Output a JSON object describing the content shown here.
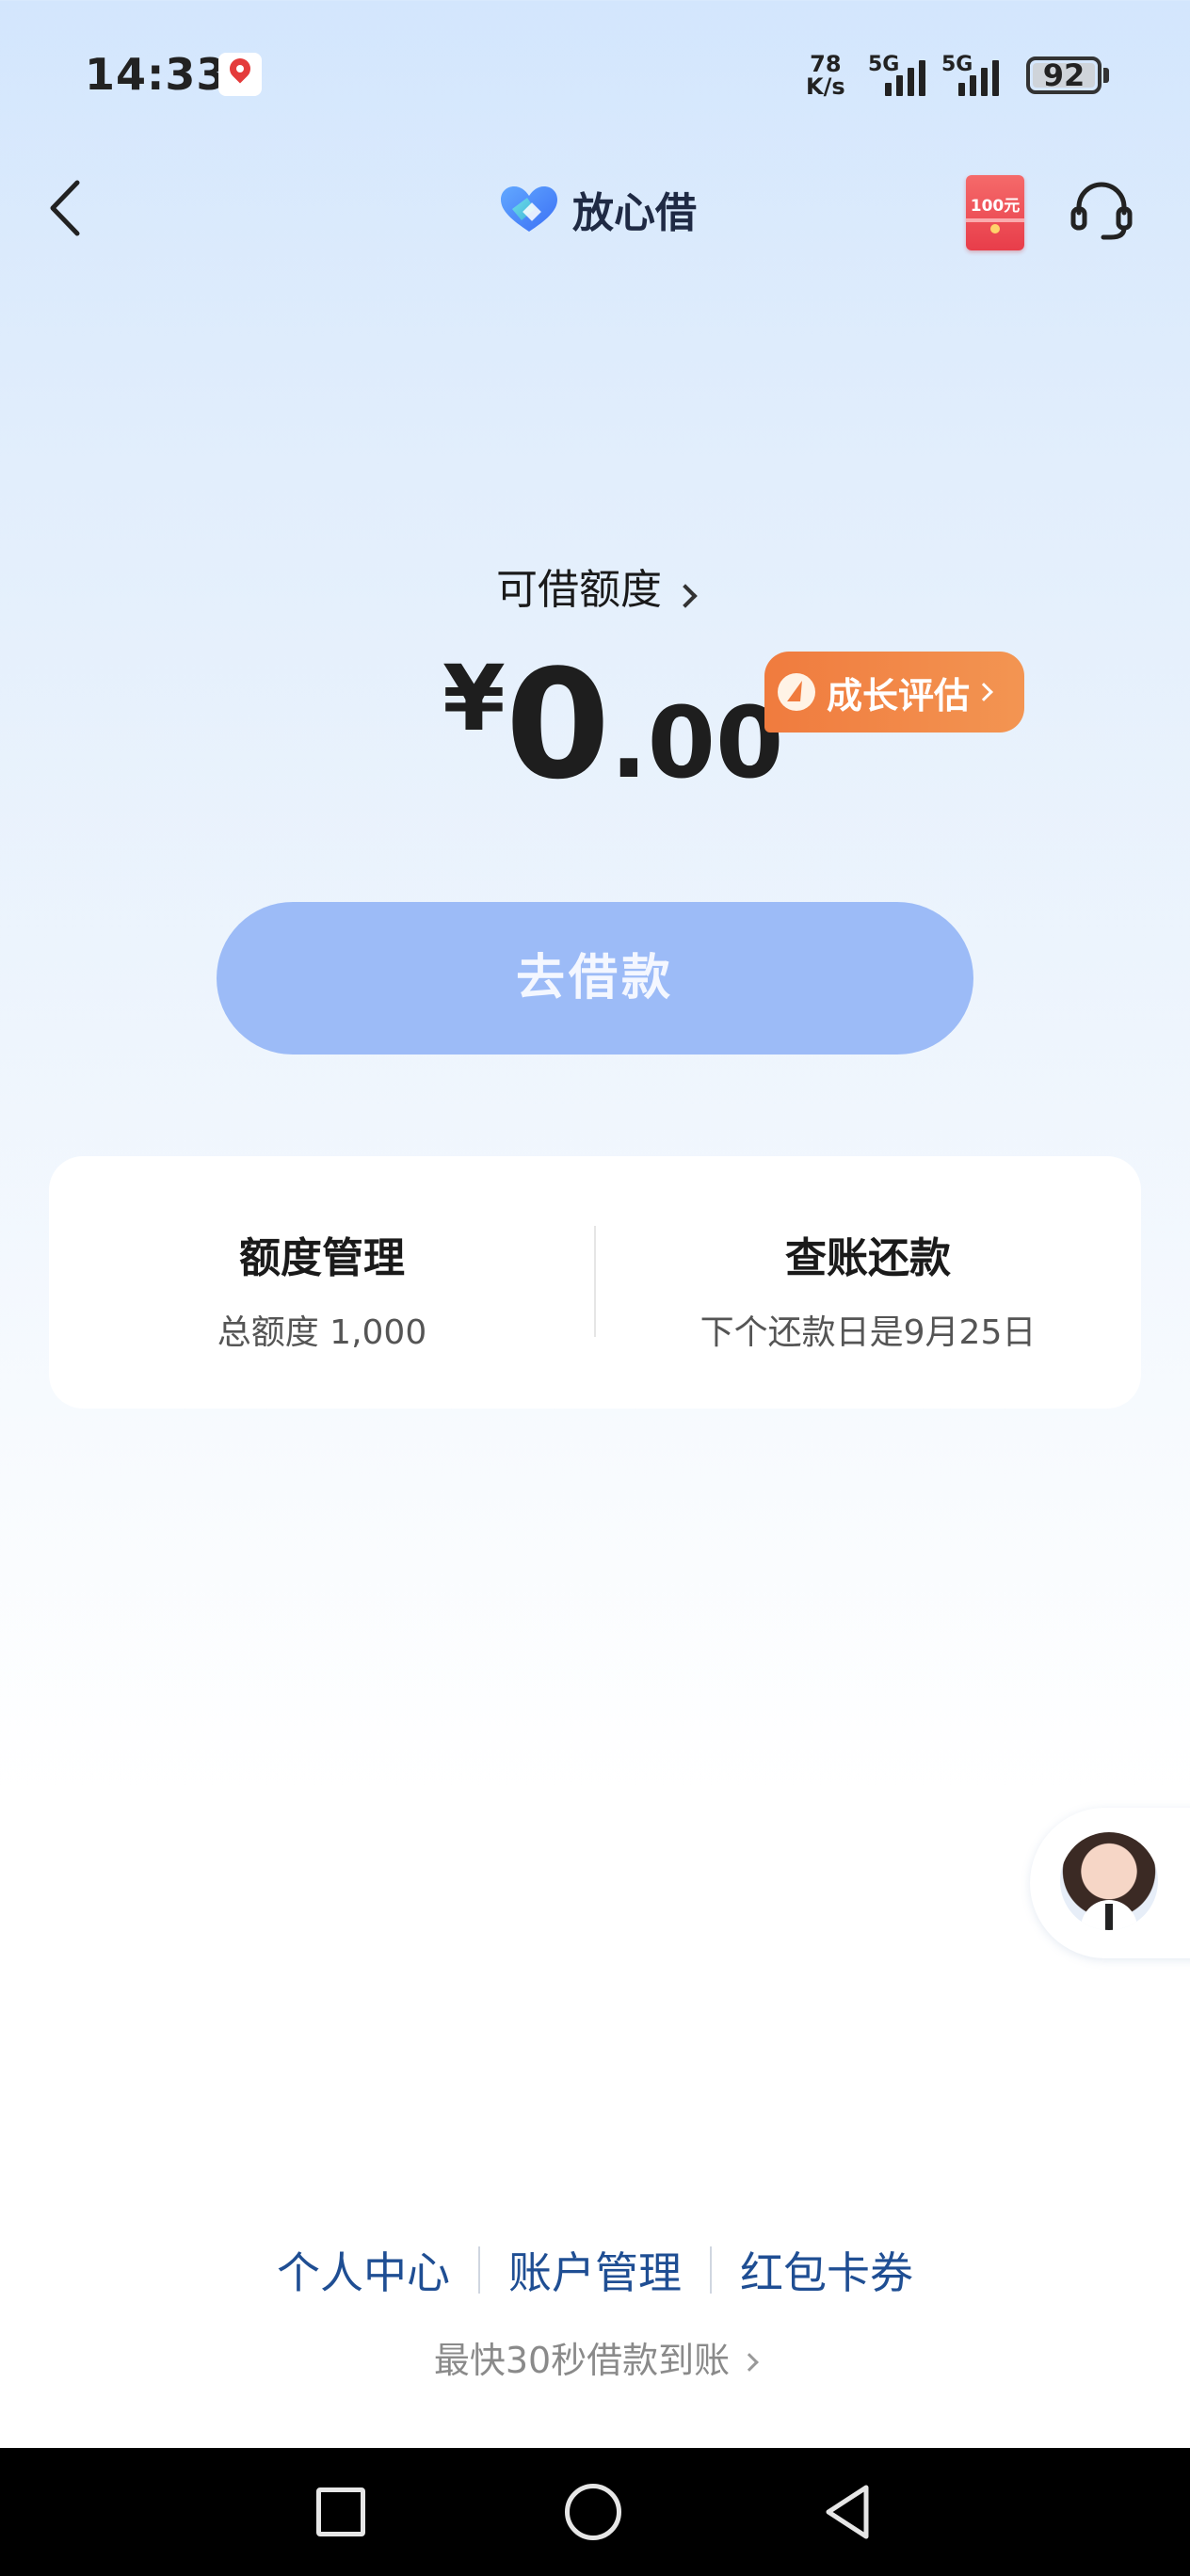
{
  "status_bar": {
    "time": "14:33",
    "net_speed_top": "78",
    "net_speed_bottom": "K/s",
    "signal_1": "5G",
    "signal_2": "5G",
    "battery": "92",
    "icons": [
      "baidu-map-icon",
      "signal-icon",
      "battery-icon"
    ]
  },
  "header": {
    "brand_name": "放心借",
    "redpacket_amount": "100元",
    "icons": [
      "back-icon",
      "brand-logo-icon",
      "red-packet-icon",
      "customer-service-icon"
    ]
  },
  "credit": {
    "label": "可借额度",
    "currency": "¥",
    "integer": "0",
    "decimal": ".00",
    "growth_label": "成长评估"
  },
  "borrow_button": {
    "label": "去借款"
  },
  "manage_card": {
    "left_title": "额度管理",
    "left_sub": "总额度 1,000",
    "right_title": "查账还款",
    "right_sub": "下个还款日是9月25日"
  },
  "footer": {
    "links": [
      "个人中心",
      "账户管理",
      "红包卡券"
    ],
    "tagline": "最快30秒借款到账"
  },
  "colors": {
    "accent_blue": "#9cbbf7",
    "growth_orange": "#f07b3e",
    "link_blue": "#1f4e93"
  }
}
